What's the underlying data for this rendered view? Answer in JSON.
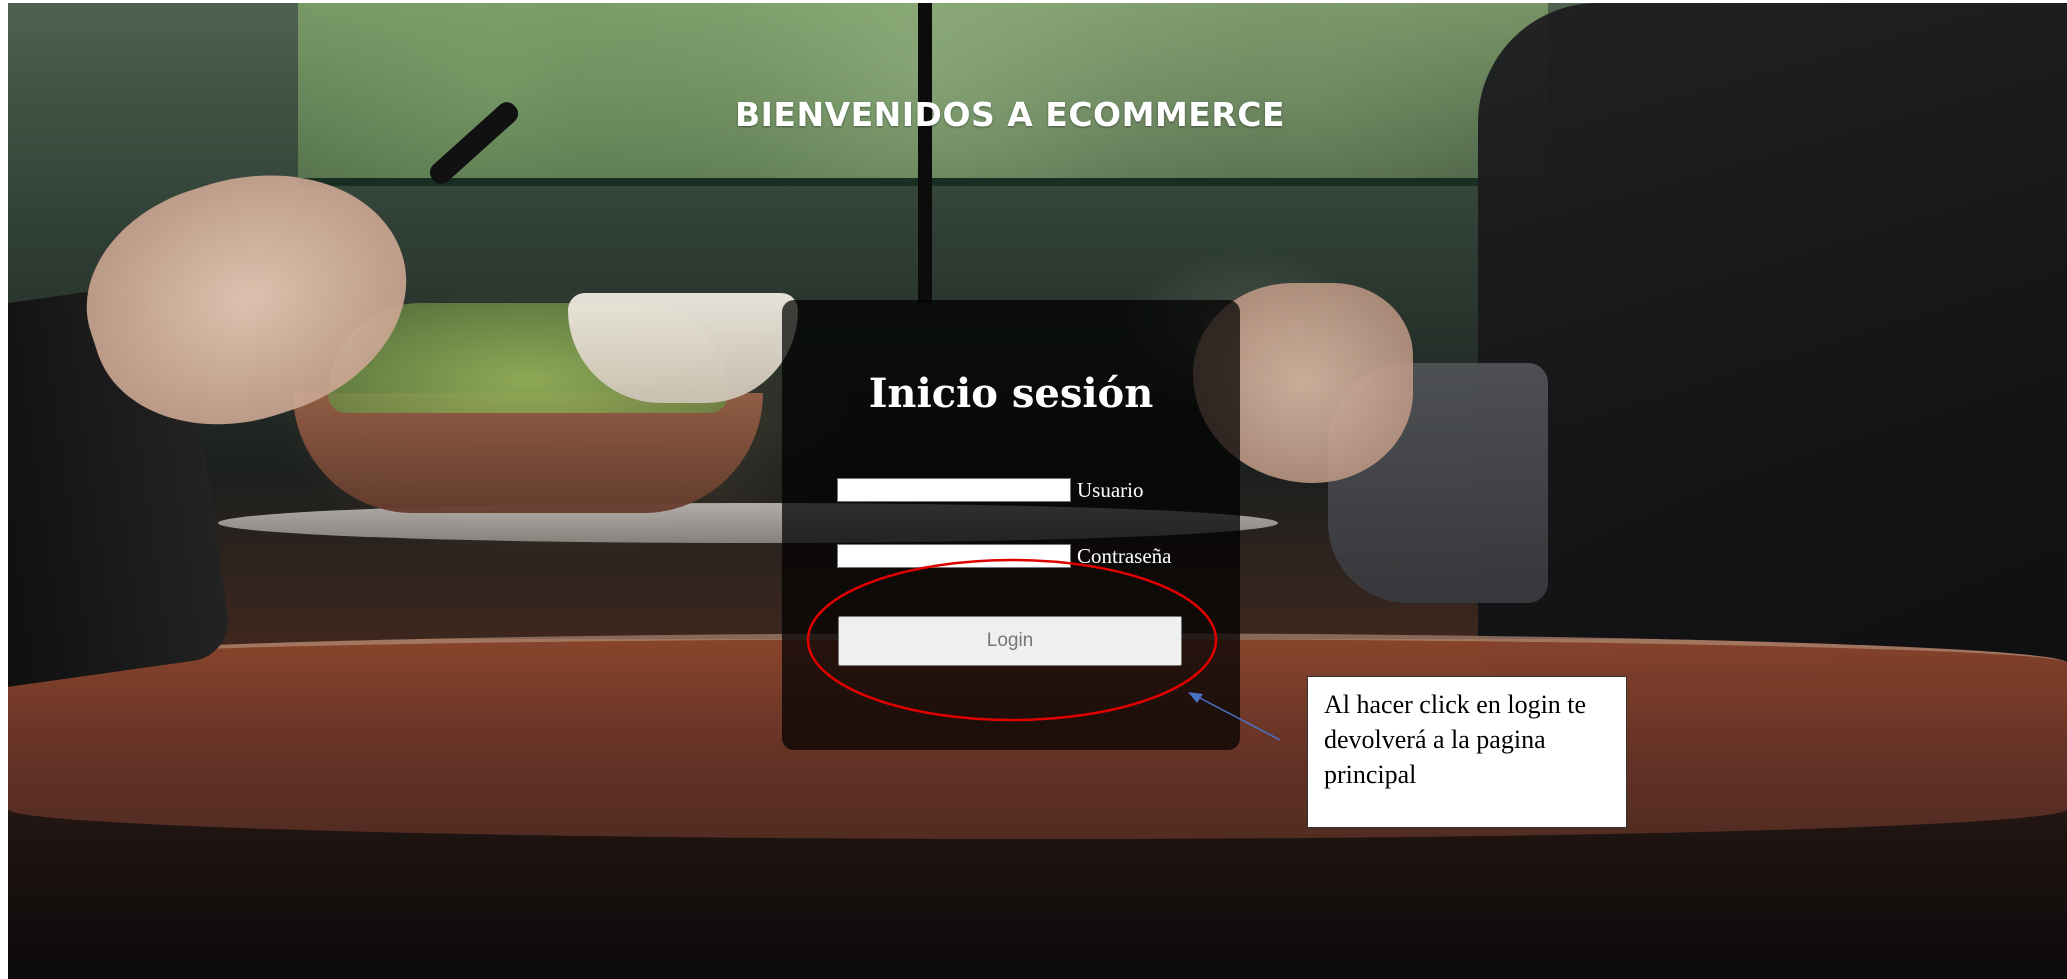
{
  "page": {
    "welcome_title": "BIENVENIDOS A ECOMMERCE"
  },
  "login_form": {
    "title": "Inicio sesión",
    "username": {
      "label": "Usuario",
      "value": "",
      "placeholder": ""
    },
    "password": {
      "label": "Contraseña",
      "value": "",
      "placeholder": ""
    },
    "submit_label": "Login"
  },
  "annotation": {
    "callout_text": "Al hacer click en login te devolverá a la pagina principal",
    "highlight_color": "#e00000",
    "arrow_color": "#4a72c4"
  },
  "colors": {
    "card_background": "rgba(0,0,0,0.72)",
    "button_background": "#efefef",
    "text_light": "#ffffff"
  }
}
